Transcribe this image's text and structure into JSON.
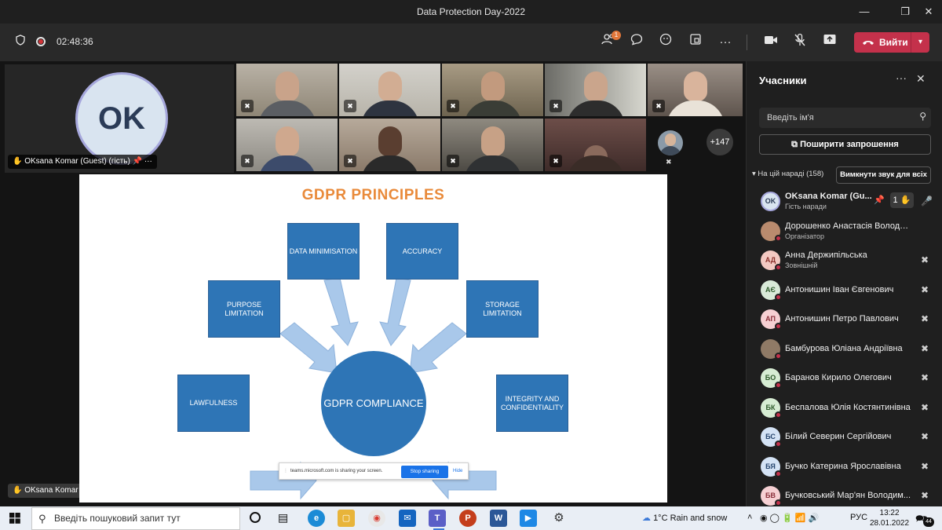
{
  "window": {
    "title": "Data Protection Day-2022",
    "controls": [
      "—",
      "❐",
      "✕"
    ]
  },
  "toolbar": {
    "timer": "02:48:36",
    "participants_badge": "1",
    "leave_label": "Вийти"
  },
  "stage": {
    "self_initials": "OK",
    "self_label": "OKsana Komar (Guest) (гість)",
    "presenter_label": "OKsana Komar (Guest) (гість)",
    "overflow_count": "+147"
  },
  "slide": {
    "title": "GDPR PRINCIPLES",
    "center": "GDPR COMPLIANCE",
    "boxes": {
      "data_min": "DATA MINIMISATION",
      "accuracy": "ACCURACY",
      "purpose": "PURPOSE LIMITATION",
      "storage": "STORAGE LIMITATION",
      "lawfulness": "LAWFULNESS",
      "integrity": "INTEGRITY AND CONFIDENTIALITY"
    },
    "share_bar": {
      "text": "teams.microsoft.com is sharing your screen.",
      "stop": "Stop sharing",
      "hide": "Hide"
    }
  },
  "panel": {
    "title": "Учасники",
    "search_placeholder": "Введіть ім'я",
    "invite_label": "Поширити запрошення",
    "section_label": "На цій нараді (158)",
    "mute_all_label": "Вимкнути звук для всіх",
    "participants": [
      {
        "initials": "OK",
        "name": "OKsana Komar (Gu...",
        "role": "Гість наради",
        "hand": "1",
        "avatar_bg": "#d9e4f0",
        "avatar_fg": "#2b3b57"
      },
      {
        "initials": "",
        "name": "Дорошенко Анастасія Володи...",
        "role": "Організатор",
        "avatar_bg": "#b98b6e",
        "avatar_fg": "#fff"
      },
      {
        "initials": "АД",
        "name": "Анна Держипільська",
        "role": "Зовнішній",
        "avatar_bg": "#f3c9c2",
        "avatar_fg": "#8a2f2a"
      },
      {
        "initials": "АЄ",
        "name": "Антонишин Іван Євгенович",
        "role": "",
        "avatar_bg": "#d9ead8",
        "avatar_fg": "#2e5b2b"
      },
      {
        "initials": "АП",
        "name": "Антонишин Петро Павлович",
        "role": "",
        "avatar_bg": "#f6d0d3",
        "avatar_fg": "#8a2f3a"
      },
      {
        "initials": "",
        "name": "Бамбурова Юліана Андріївна",
        "role": "",
        "avatar_bg": "#8f7a66",
        "avatar_fg": "#fff"
      },
      {
        "initials": "БО",
        "name": "Баранов Кирило Олегович",
        "role": "",
        "avatar_bg": "#d6ecd3",
        "avatar_fg": "#2e5b2b"
      },
      {
        "initials": "БК",
        "name": "Беспалова Юлія Костянтинівна",
        "role": "",
        "avatar_bg": "#d6ecd3",
        "avatar_fg": "#2e5b2b"
      },
      {
        "initials": "БС",
        "name": "Білий Северин Сергійович",
        "role": "",
        "avatar_bg": "#d4e3f5",
        "avatar_fg": "#27466e"
      },
      {
        "initials": "БЯ",
        "name": "Бучко Катерина Ярославівна",
        "role": "",
        "avatar_bg": "#d4e3f5",
        "avatar_fg": "#27466e"
      },
      {
        "initials": "БВ",
        "name": "Бучковський Мар'ян Володим...",
        "role": "",
        "avatar_bg": "#f6d0d3",
        "avatar_fg": "#8a2f3a"
      }
    ]
  },
  "taskbar": {
    "search_placeholder": "Введіть пошуковий запит тут",
    "weather": "1°C  Rain and snow",
    "lang": "РУС",
    "time": "13:22",
    "date": "28.01.2022",
    "notifications": "44"
  }
}
